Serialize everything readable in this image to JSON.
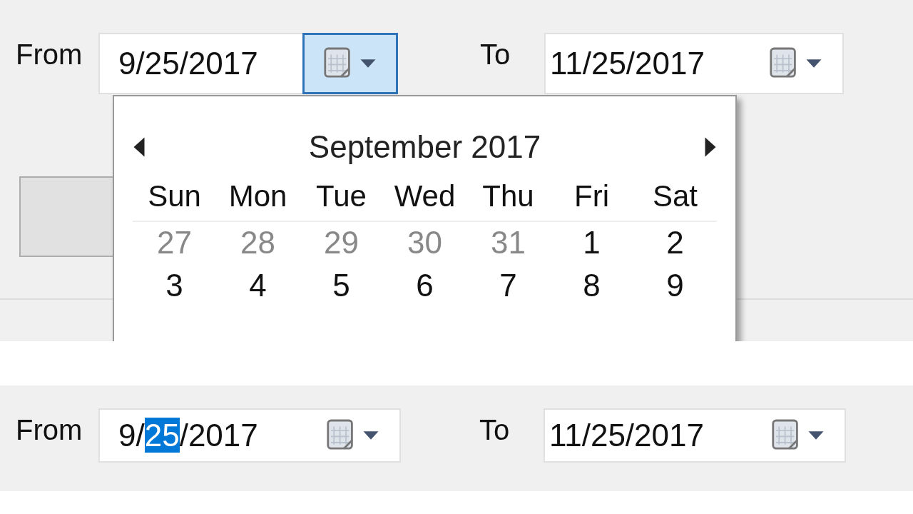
{
  "panels": [
    {
      "from": {
        "label": "From",
        "segments": [
          {
            "text": "9/",
            "selected": false
          },
          {
            "text": "25",
            "selected": false
          },
          {
            "text": "/2017",
            "selected": false
          }
        ],
        "dropdown_active": true
      },
      "to": {
        "label": "To",
        "segments": [
          {
            "text": "11/",
            "selected": false
          },
          {
            "text": "25",
            "selected": false
          },
          {
            "text": "/2017",
            "selected": false
          }
        ],
        "dropdown_active": false
      },
      "calendar": {
        "month": "September 2017",
        "weekdays": [
          "Sun",
          "Mon",
          "Tue",
          "Wed",
          "Thu",
          "Fri",
          "Sat"
        ],
        "weeks": [
          [
            {
              "day": "27",
              "other_month": true
            },
            {
              "day": "28",
              "other_month": true
            },
            {
              "day": "29",
              "other_month": true
            },
            {
              "day": "30",
              "other_month": true
            },
            {
              "day": "31",
              "other_month": true
            },
            {
              "day": "1",
              "other_month": false
            },
            {
              "day": "2",
              "other_month": false
            }
          ],
          [
            {
              "day": "3",
              "other_month": false
            },
            {
              "day": "4",
              "other_month": false
            },
            {
              "day": "5",
              "other_month": false
            },
            {
              "day": "6",
              "other_month": false
            },
            {
              "day": "7",
              "other_month": false
            },
            {
              "day": "8",
              "other_month": false
            },
            {
              "day": "9",
              "other_month": false
            }
          ]
        ]
      }
    },
    {
      "from": {
        "label": "From",
        "segments": [
          {
            "text": "9/",
            "selected": false
          },
          {
            "text": "25",
            "selected": true
          },
          {
            "text": "/2017",
            "selected": false
          }
        ],
        "dropdown_active": false
      },
      "to": {
        "label": "To",
        "segments": [
          {
            "text": "11/",
            "selected": false
          },
          {
            "text": "25",
            "selected": false
          },
          {
            "text": "/2017",
            "selected": false
          }
        ],
        "dropdown_active": false
      }
    }
  ]
}
